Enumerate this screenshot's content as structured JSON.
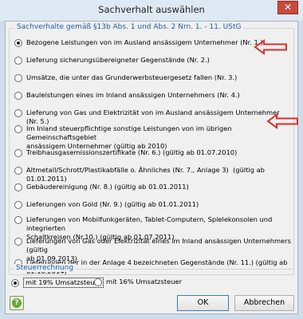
{
  "window": {
    "title": "Sachverhalt auswählen"
  },
  "group_sachverhalte": {
    "legend": "Sachverhalte gemäß §13b Abs. 1 und Abs. 2 Nrn. 1. - 11. UStG",
    "options": [
      {
        "label": "Bezogene Leistungen von im Ausland ansässigem Unternehmer (Nr. 1.)",
        "checked": true
      },
      {
        "label": "Lieferung sicherungsübereigneter Gegenstände (Nr. 2.)",
        "checked": false
      },
      {
        "label": "Umsätze, die unter das Grunderwerbsteuergesetz fallen (Nr. 3.)",
        "checked": false
      },
      {
        "label": "Bauleistungen eines im Inland ansässigen Unternehmers (Nr. 4.)",
        "checked": false
      },
      {
        "label": "Lieferung von Gas und Elektrizität von im Ausland ansässigem Unternehmer (Nr. 5.)",
        "checked": false
      },
      {
        "label": "Im Inland steuerpflichtige sonstige Leistungen von im übrigen Gemeinschaftsgebiet\nansässigem Unternehmer (gültig ab 2010)",
        "checked": false
      },
      {
        "label": "Treibhausgasemissionszertifikate (Nr. 6.) (gültig ab 01.07.2010)",
        "checked": false
      },
      {
        "label": "Altmetall/Schrott/Plastikabfälle o. Ähnliches (Nr. 7., Anlage 3)  (gültig ab 01.01.2011)",
        "checked": false
      },
      {
        "label": "Gebäudereinigung (Nr. 8.) (gültig ab 01.01.2011)",
        "checked": false
      },
      {
        "label": "Lieferungen von Gold (Nr. 9.) (gültig ab 01.01.2011)",
        "checked": false
      },
      {
        "label": "Lieferungen von Mobilfunkgeräten, Tablet-Computern, Spielekonsolen und integrierten\nSchaltkreisen (Nr.10.) (gültig ab 01.07.2011)",
        "checked": false
      },
      {
        "label": "Lieferungen von Gas oder Elektrizität eines im Inland ansässigen Unternehmers (gültig\nab 01.09.2013)",
        "checked": false
      },
      {
        "label": "Lieferungen der in der Anlage 4 bezeichneten Gegenstände (Nr. 11.) (gültig ab\n01.10.2014)",
        "checked": false
      }
    ]
  },
  "group_steuer": {
    "legend": "Steuerrechnung",
    "options": [
      {
        "label": "mit 19% Umsatzsteuer",
        "checked": true
      },
      {
        "label": "mit 16% Umsatzsteuer",
        "checked": false
      }
    ]
  },
  "buttons": {
    "help": "?",
    "ok": "OK",
    "cancel": "Abbrechen"
  },
  "colors": {
    "annotation_arrow": "#d9302a",
    "help_green": "#6fa63a"
  }
}
